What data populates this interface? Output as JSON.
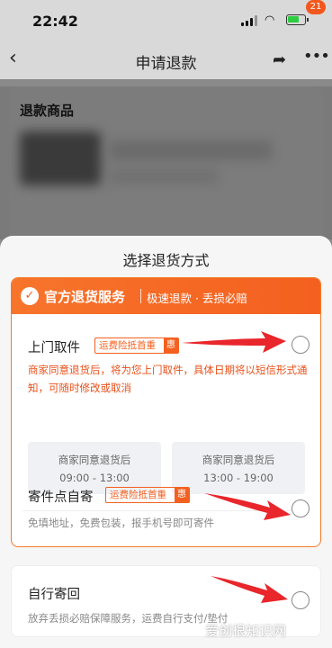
{
  "status_bar": {
    "time": "22:42"
  },
  "nav": {
    "back_glyph": "‹",
    "title": "申请退款",
    "badge_count": "21"
  },
  "refund_section": {
    "title": "退款商品"
  },
  "sheet": {
    "title": "选择退货方式",
    "official": {
      "title": "官方退货服务",
      "subtitle": "极速退款 · 丢损必赔",
      "options": [
        {
          "title": "上门取件",
          "tag": "运费险抵首重",
          "tag_badge": "惠",
          "desc": "商家同意退货后，将为您上门取件，具体日期将以短信形式通知，可随时修改或取消",
          "slots": [
            {
              "label": "商家同意退货后",
              "time": "09:00 - 13:00"
            },
            {
              "label": "商家同意退货后",
              "time": "13:00 - 19:00"
            }
          ]
        },
        {
          "title": "寄件点自寄",
          "tag": "运费险抵首重",
          "tag_badge": "惠",
          "desc": "免填地址，免费包装，报手机号即可寄件"
        }
      ]
    },
    "self_send": {
      "title": "自行寄回",
      "desc": "放弃丢损必赔保障服务，运费自行支付/垫付"
    }
  },
  "watermark": "爱创根知识网",
  "colors": {
    "accent": "#f4601f",
    "annotation_arrow": "#e8262b"
  }
}
